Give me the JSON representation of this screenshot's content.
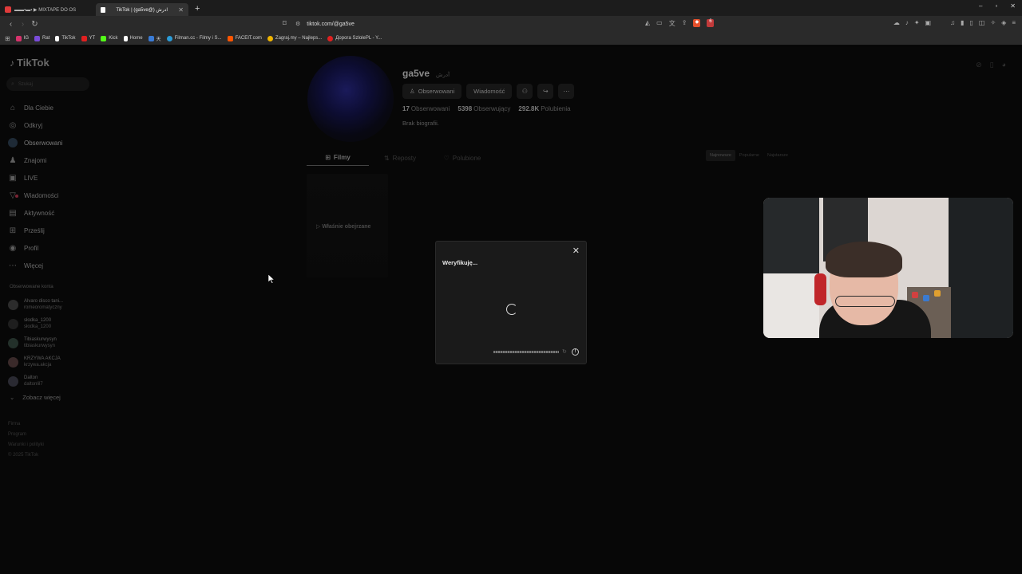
{
  "browser": {
    "tabs": [
      {
        "label": "▬▬▪▬▪ ▶ MIXTAPE DO OS",
        "active": false,
        "favicon_color": "#e03b3b"
      },
      {
        "label": "TikTok | (ga5ve@) آدرش",
        "active": true,
        "favicon_color": "#ffffff"
      }
    ],
    "new_tab": "+",
    "window_controls": [
      "–",
      "▫",
      "✕"
    ],
    "url": "tiktok.com/@ga5ve",
    "shield_badge": "6",
    "bookmarks": [
      {
        "label": "IG",
        "color": "#d6336c"
      },
      {
        "label": "Rat",
        "color": "#7a4cd9"
      },
      {
        "label": "TikTok",
        "color": "#ffffff"
      },
      {
        "label": "YT",
        "color": "#e02020"
      },
      {
        "label": "Kick",
        "color": "#53fc18"
      },
      {
        "label": "Home",
        "color": "#ffffff"
      },
      {
        "label": "天",
        "color": "#3a7bd5"
      },
      {
        "label": "Filman.cc - Filmy i S...",
        "color": "#2b9cd8"
      },
      {
        "label": "FACEIT.com",
        "color": "#ff5500"
      },
      {
        "label": "Zagraj.my – Najleps...",
        "color": "#f0b400"
      },
      {
        "label": "Дорога SzlolePL - Y...",
        "color": "#e02020"
      }
    ]
  },
  "tiktok": {
    "logo": "TikTok",
    "search_placeholder": "Szukaj",
    "nav": [
      {
        "label": "Dla Ciebie",
        "icon": "home-icon",
        "glyph": "⌂"
      },
      {
        "label": "Odkryj",
        "icon": "compass-icon",
        "glyph": "◎"
      },
      {
        "label": "Obserwowani",
        "icon": "following-avatar-icon",
        "glyph": "●"
      },
      {
        "label": "Znajomi",
        "icon": "friends-icon",
        "glyph": "♟"
      },
      {
        "label": "LIVE",
        "icon": "live-icon",
        "glyph": "▣"
      },
      {
        "label": "Wiadomości",
        "icon": "messages-icon",
        "glyph": "▽"
      },
      {
        "label": "Aktywność",
        "icon": "activity-icon",
        "glyph": "▤"
      },
      {
        "label": "Prześlij",
        "icon": "upload-icon",
        "glyph": "⊞"
      },
      {
        "label": "Profil",
        "icon": "profile-icon",
        "glyph": "◉"
      },
      {
        "label": "Więcej",
        "icon": "more-icon",
        "glyph": "⋯"
      }
    ],
    "followed_title": "Obserwowane konta",
    "followed": [
      {
        "name": "Alvaro disco tani...",
        "handle": "romeoromatyczny"
      },
      {
        "name": "słodka_1200",
        "handle": "słodka_1200"
      },
      {
        "name": "Tibiaskurwysyn",
        "handle": "tibiaskurwysyn"
      },
      {
        "name": "KRZYWA AKCJA",
        "handle": "krzywa.akcja"
      },
      {
        "name": "Dalton",
        "handle": "daltonlil7"
      }
    ],
    "see_more": "Zobacz więcej",
    "footer": [
      "Firma",
      "Program",
      "Warunki i polityki",
      "© 2025 TikTok"
    ]
  },
  "profile": {
    "username": "ga5ve",
    "nickname": "آدرش",
    "buttons": {
      "following": "Obserwowani",
      "message": "Wiadomość"
    },
    "stats": [
      {
        "value": "17",
        "label": "Obserwowani"
      },
      {
        "value": "5398",
        "label": "Obserwujący"
      },
      {
        "value": "292.8K",
        "label": "Polubienia"
      }
    ],
    "bio": "Brak biografii.",
    "tabs": [
      {
        "label": "Filmy",
        "active": true
      },
      {
        "label": "Reposty",
        "active": false
      },
      {
        "label": "Polubione",
        "active": false
      }
    ],
    "sort": [
      "Najnowsze",
      "Popularne",
      "Najstarsze"
    ],
    "thumb_label": "▷ Właśnie obejrzane"
  },
  "modal": {
    "title": "Weryfikuję...",
    "close": "✕",
    "info": "!"
  }
}
